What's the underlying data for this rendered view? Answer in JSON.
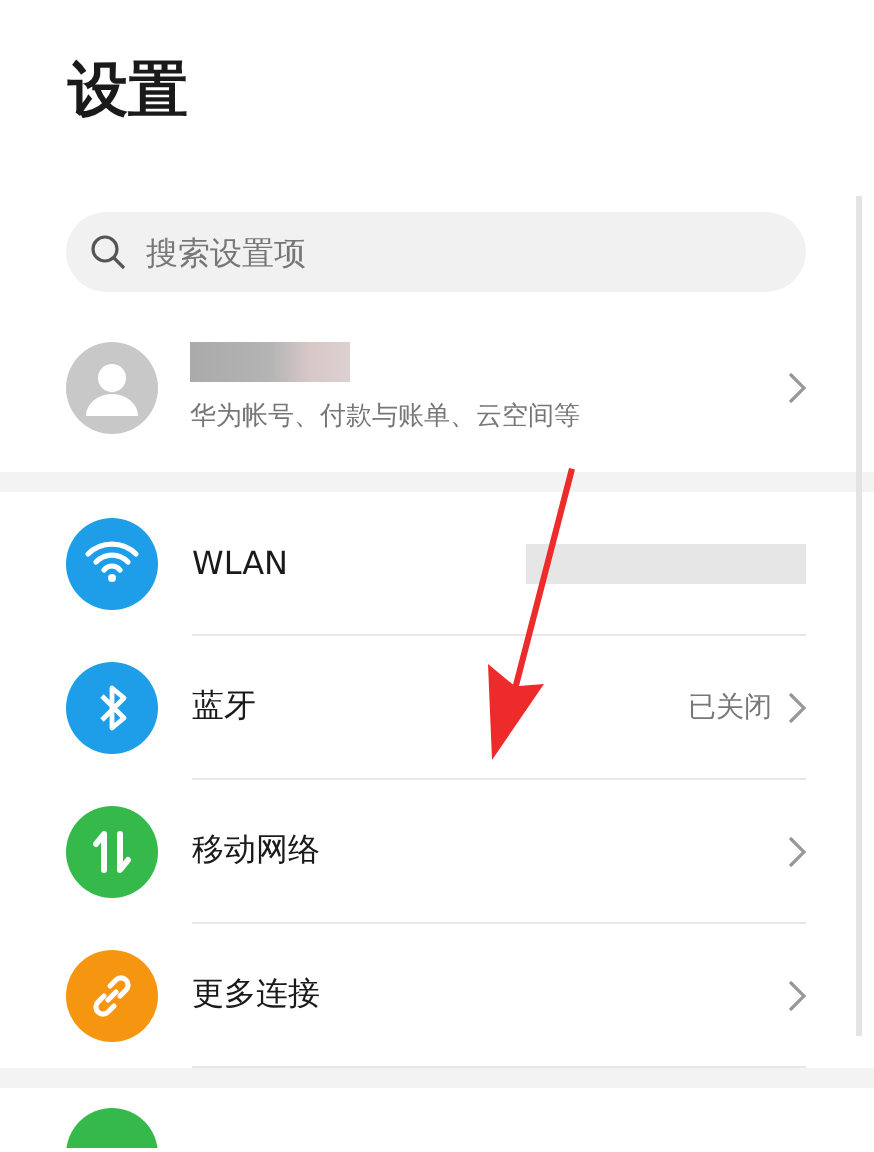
{
  "title": "设置",
  "search": {
    "placeholder": "搜索设置项"
  },
  "account": {
    "subtitle": "华为帐号、付款与账单、云空间等"
  },
  "rows": [
    {
      "label": "WLAN",
      "color": "#1e9ee8",
      "value_blurred": true,
      "chevron": false
    },
    {
      "label": "蓝牙",
      "color": "#1e9ee8",
      "value": "已关闭",
      "value_blurred": false,
      "chevron": true
    },
    {
      "label": "移动网络",
      "color": "#35b94a",
      "value_blurred": false,
      "chevron": true
    },
    {
      "label": "更多连接",
      "color": "#f6950f",
      "value_blurred": false,
      "chevron": true
    }
  ],
  "next_row": {
    "color": "#35b94a"
  }
}
